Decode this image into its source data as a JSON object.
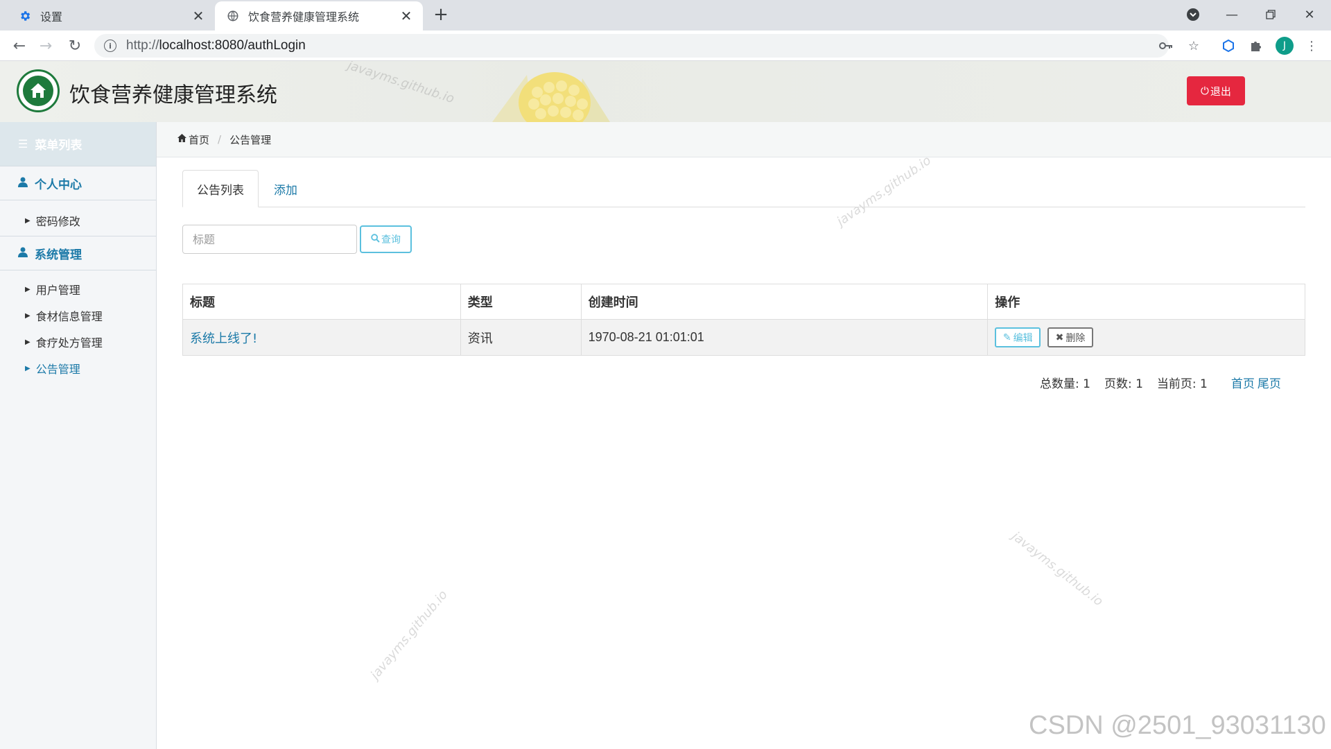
{
  "browser": {
    "tabs": [
      {
        "title": "设置",
        "icon": "gear-icon"
      },
      {
        "title": "饮食营养健康管理系统",
        "icon": "globe-icon"
      }
    ],
    "url": "http://localhost:8080/authLogin",
    "url_prefix": "http://",
    "url_rest": "localhost:8080/authLogin",
    "profile_initial": "J"
  },
  "header": {
    "title": "饮食营养健康管理系统",
    "logout_label": "退出",
    "logout_color": "#e5273f"
  },
  "sidebar": {
    "title": "菜单列表",
    "groups": [
      {
        "label": "个人中心",
        "items": [
          "密码修改"
        ]
      },
      {
        "label": "系统管理",
        "items": [
          "用户管理",
          "食材信息管理",
          "食疗处方管理",
          "公告管理"
        ]
      }
    ],
    "active_item": "公告管理"
  },
  "breadcrumb": {
    "home": "首页",
    "current": "公告管理"
  },
  "content_tabs": {
    "list": "公告列表",
    "add": "添加"
  },
  "search": {
    "placeholder": "标题",
    "value": "",
    "button": "查询"
  },
  "table": {
    "headers": [
      "标题",
      "类型",
      "创建时间",
      "操作"
    ],
    "rows": [
      {
        "title": "系统上线了!",
        "type": "资讯",
        "created": "1970-08-21 01:01:01",
        "edit_label": "编辑",
        "delete_label": "删除"
      }
    ]
  },
  "pagination": {
    "total_label": "总数量: 1",
    "pages_label": "页数: 1",
    "current_label": "当前页: 1",
    "first": "首页",
    "last": "尾页"
  },
  "watermarks": {
    "site": "javayms.github.io",
    "csdn": "CSDN @2501_93031130"
  },
  "colors": {
    "accent": "#1c7aa8",
    "info": "#5bc0de"
  }
}
